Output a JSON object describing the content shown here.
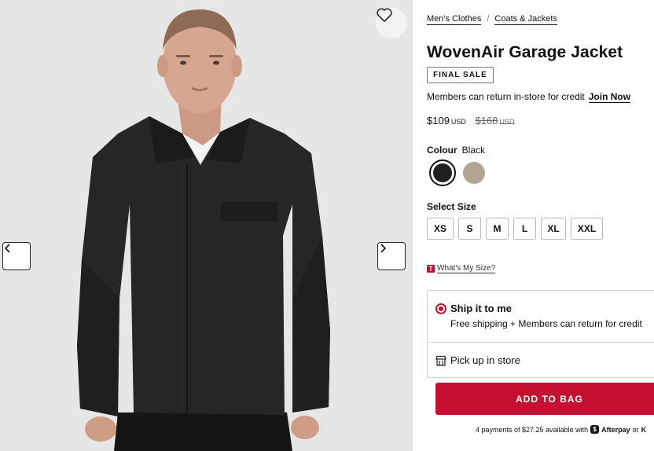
{
  "breadcrumb": {
    "items": [
      "Men's Clothes",
      "Coats & Jackets"
    ],
    "separator": "/"
  },
  "product": {
    "title": "WovenAir Garage Jacket",
    "badge": "FINAL SALE",
    "members_text": "Members can return in-store for credit",
    "join_link": "Join Now",
    "price": {
      "current": "$109",
      "currency": "USD",
      "original": "$168",
      "original_currency": "USD"
    },
    "colour": {
      "label": "Colour",
      "selected": "Black",
      "swatches": [
        {
          "name": "Black",
          "hex": "#1f1f1f",
          "selected": true
        },
        {
          "name": "Tan",
          "hex": "#b1a490",
          "selected": false
        }
      ]
    },
    "size": {
      "label": "Select Size",
      "options": [
        "XS",
        "S",
        "M",
        "L",
        "XL",
        "XXL"
      ]
    },
    "size_help": {
      "tag": "T",
      "link": "What's My Size?"
    },
    "fulfillment": {
      "ship": {
        "title": "Ship it to me",
        "subtitle": "Free shipping + Members can return for credit",
        "selected": true
      },
      "pickup": {
        "title": "Pick up in store"
      }
    },
    "add_to_bag": "ADD TO BAG",
    "installments": {
      "text": "4 payments of $27.25 available with",
      "provider": "Afterpay",
      "or": "or",
      "trail": "K"
    }
  },
  "gallery": {
    "wishlist_icon": "heart-outline-icon",
    "prev_icon": "chevron-left-icon",
    "next_icon": "chevron-right-icon"
  },
  "colors": {
    "accent": "#c5102f",
    "image_bg": "#e6e6e6"
  }
}
